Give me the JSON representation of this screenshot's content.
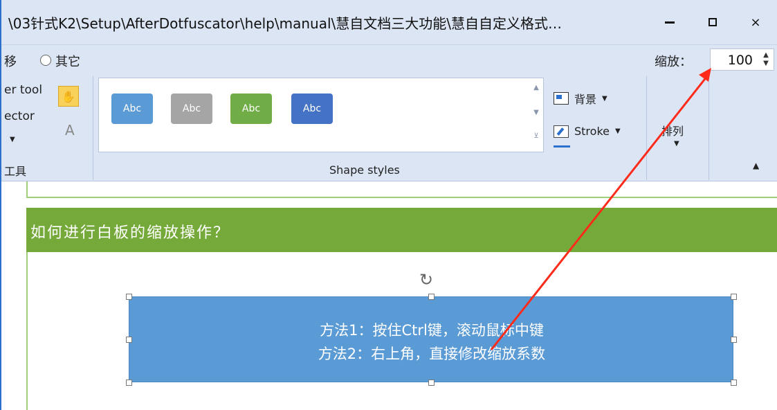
{
  "window": {
    "title": "\\03针式K2\\Setup\\AfterDotfuscator\\help\\manual\\慧自文档三大功能\\慧自自定义格式…",
    "controls": {
      "minimize": "minimize-icon",
      "maximize": "maximize-icon",
      "close": "×"
    }
  },
  "options": {
    "move_label": "移",
    "other_label": "其它",
    "zoom_label": "缩放：",
    "zoom_value": "100"
  },
  "ribbon": {
    "tools_partial": [
      "er tool",
      "ector"
    ],
    "tools_group_label": "工具",
    "hand_icon": "hand-icon",
    "text_tool": "A",
    "gallery": [
      {
        "label": "Abc",
        "color": "#5b9bd5"
      },
      {
        "label": "Abc",
        "color": "#a5a5a5"
      },
      {
        "label": "Abc",
        "color": "#70ad47"
      },
      {
        "label": "Abc",
        "color": "#4472c4"
      }
    ],
    "shape_styles_label": "Shape styles",
    "background_label": "背景",
    "stroke_label": "Stroke",
    "arrange_label": "排列"
  },
  "canvas": {
    "heading": "如何进行白板的缩放操作？",
    "shape_line1": "方法1：按住Ctrl键，滚动鼠标中键",
    "shape_line2": "方法2：右上角，直接修改缩放系数",
    "annotation_color": "#ff2a1a"
  }
}
